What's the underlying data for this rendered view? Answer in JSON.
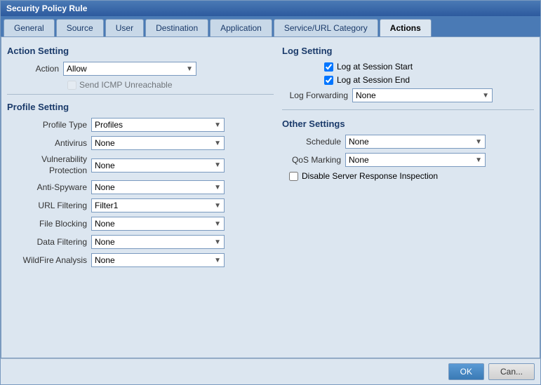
{
  "title": "Security Policy Rule",
  "tabs": [
    {
      "id": "general",
      "label": "General",
      "active": false
    },
    {
      "id": "source",
      "label": "Source",
      "active": false
    },
    {
      "id": "user",
      "label": "User",
      "active": false
    },
    {
      "id": "destination",
      "label": "Destination",
      "active": false
    },
    {
      "id": "application",
      "label": "Application",
      "active": false
    },
    {
      "id": "service-url",
      "label": "Service/URL Category",
      "active": false
    },
    {
      "id": "actions",
      "label": "Actions",
      "active": true
    }
  ],
  "left": {
    "action_setting_title": "Action Setting",
    "action_label": "Action",
    "action_value": "Allow",
    "send_icmp_label": "Send ICMP Unreachable",
    "send_icmp_disabled": true,
    "profile_setting_title": "Profile Setting",
    "profile_type_label": "Profile Type",
    "profile_type_value": "Profiles",
    "rows": [
      {
        "label": "Antivirus",
        "value": "None"
      },
      {
        "label": "Vulnerability Protection",
        "value": "None"
      },
      {
        "label": "Anti-Spyware",
        "value": "None"
      },
      {
        "label": "URL Filtering",
        "value": "Filter1"
      },
      {
        "label": "File Blocking",
        "value": "None"
      },
      {
        "label": "Data Filtering",
        "value": "None"
      },
      {
        "label": "WildFire Analysis",
        "value": "None"
      }
    ]
  },
  "right": {
    "log_setting_title": "Log Setting",
    "log_session_start_label": "Log at Session Start",
    "log_session_start_checked": true,
    "log_session_end_label": "Log at Session End",
    "log_session_end_checked": true,
    "log_forwarding_label": "Log Forwarding",
    "log_forwarding_value": "None",
    "other_settings_title": "Other Settings",
    "schedule_label": "Schedule",
    "schedule_value": "None",
    "qos_label": "QoS Marking",
    "qos_value": "None",
    "disable_server_label": "Disable Server Response Inspection"
  },
  "footer": {
    "ok_label": "OK",
    "cancel_label": "Can..."
  }
}
